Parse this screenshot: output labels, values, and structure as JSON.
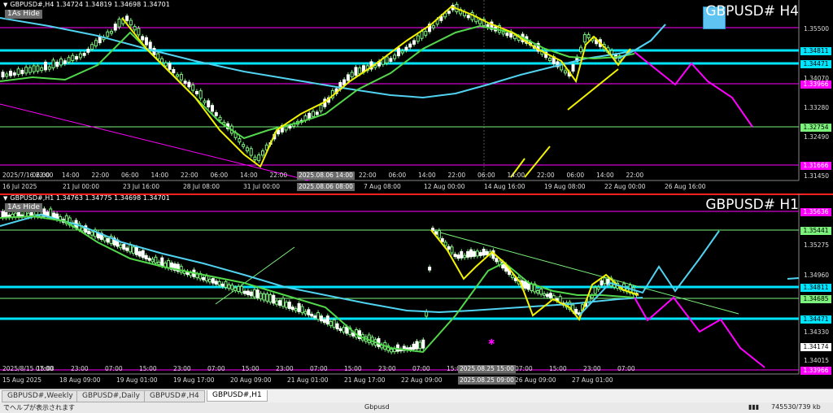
{
  "h4": {
    "info": "GBPUSD#,H4  1.34724 1.34819 1.34698 1.34701",
    "hide": "1As Hide",
    "symbol": "GBPUSD#  H4",
    "y_ticks": [
      "1.35500",
      "1.34070",
      "1.33280",
      "1.32490",
      "1.31450"
    ],
    "y_boxes": [
      {
        "t": "1.34811",
        "bg": "#00e5ff",
        "fg": "#000"
      },
      {
        "t": "1.34471",
        "bg": "#00e5ff",
        "fg": "#000"
      },
      {
        "t": "1.33966",
        "bg": "#ff00ff",
        "fg": "#fff"
      },
      {
        "t": "1.32754",
        "bg": "#7cf27c",
        "fg": "#000"
      },
      {
        "t": "1.31666",
        "bg": "#ff00ff",
        "fg": "#fff"
      }
    ],
    "x_labels": [
      "2025/7/16 22:00",
      "06:00",
      "14:00",
      "22:00",
      "06:00",
      "14:00",
      "22:00",
      "06:00",
      "14:00",
      "22:00",
      "06:00",
      "14:00",
      "22:00",
      "06:00",
      "14:00",
      "22:00",
      "06:00",
      "14:00",
      "22:00",
      "06:00",
      "14:00",
      "22:00"
    ],
    "x_labels2": [
      "16 Jul 2025",
      "21 Jul 00:00",
      "23 Jul 16:00",
      "28 Jul 08:00",
      "31 Jul 00:00",
      "4 Aug",
      "7 Aug 08:00",
      "12 Aug 00:00",
      "14 Aug 16:00",
      "19 Aug 08:00",
      "22 Aug 00:00",
      "26 Aug 16:00"
    ],
    "cursor_time": "2025.08.06 14:00",
    "cursor_time2": "2025.08.06 08:00"
  },
  "h1": {
    "info": "GBPUSD#,H1  1.34763 1.34775 1.34698 1.34701",
    "hide": "1As Hide",
    "symbol": "GBPUSD#  H1",
    "y_ticks": [
      "1.35275",
      "1.34960",
      "1.34330",
      "1.34015"
    ],
    "y_boxes": [
      {
        "t": "1.35636",
        "bg": "#ff00ff",
        "fg": "#fff"
      },
      {
        "t": "1.35441",
        "bg": "#7cf27c",
        "fg": "#000"
      },
      {
        "t": "1.34811",
        "bg": "#00e5ff",
        "fg": "#000"
      },
      {
        "t": "1.34685",
        "bg": "#7cf27c",
        "fg": "#000"
      },
      {
        "t": "1.34471",
        "bg": "#00e5ff",
        "fg": "#000"
      },
      {
        "t": "1.34174",
        "bg": "#fff",
        "fg": "#000"
      },
      {
        "t": "1.33966",
        "bg": "#ff00ff",
        "fg": "#fff"
      }
    ],
    "x_labels": [
      "2025/8/15 07:00",
      "15:00",
      "23:00",
      "07:00",
      "15:00",
      "23:00",
      "07:00",
      "15:00",
      "23:00",
      "07:00",
      "15:00",
      "23:00",
      "07:00",
      "15:00",
      "23:00",
      "07:00",
      "15:00",
      "23:00",
      "07:00"
    ],
    "x_labels2": [
      "15 Aug 2025",
      "18 Aug 09:00",
      "19 Aug 01:00",
      "19 Aug 17:00",
      "20 Aug 09:00",
      "21 Aug 01:00",
      "21 Aug 17:00",
      "22 Aug 09:00",
      "25 Aug 17:00",
      "26 Aug 09:00",
      "27 Aug 01:00"
    ],
    "cursor_time": "2025.08.25 15:00",
    "cursor_time2": "2025.08.25 09:00"
  },
  "tabs": [
    "GBPUSD#,Weekly",
    "GBPUSD#,Daily",
    "GBPUSD#,H4",
    "GBPUSD#,H1"
  ],
  "active_tab": "GBPUSD#,H1",
  "status": {
    "help": "でヘルプが表示されます",
    "profile": "Gbpusd",
    "traffic": "745530/739 kb"
  }
}
